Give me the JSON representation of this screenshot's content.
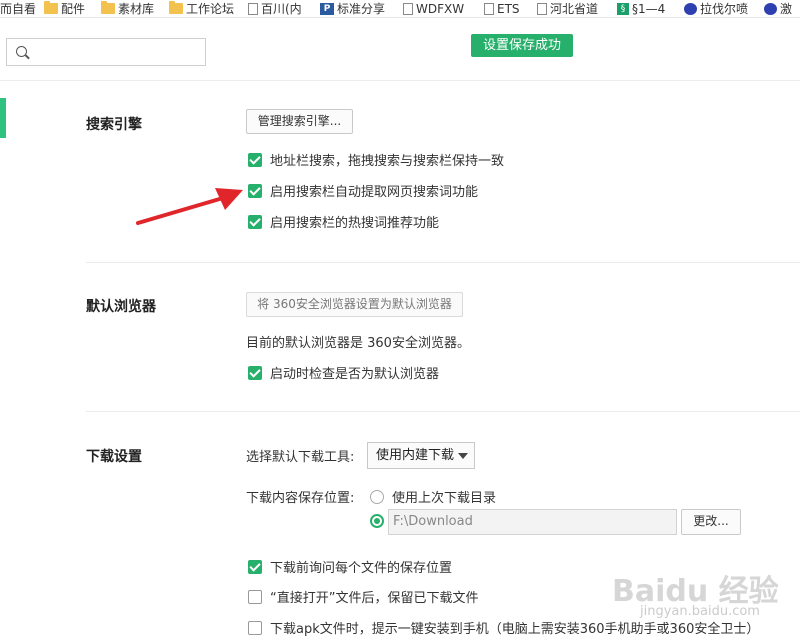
{
  "bookmarks": [
    {
      "label": "而自看",
      "icon": "none"
    },
    {
      "label": "配件",
      "icon": "folder-icon"
    },
    {
      "label": "素材库",
      "icon": "folder-icon"
    },
    {
      "label": "工作论坛",
      "icon": "folder-icon"
    },
    {
      "label": "百川(内",
      "icon": "page-icon"
    },
    {
      "label": "标准分享",
      "icon": "logo-icon"
    },
    {
      "label": "WDFXW",
      "icon": "page-icon"
    },
    {
      "label": "ETS",
      "icon": "page-icon"
    },
    {
      "label": "河北省道",
      "icon": "page-icon"
    },
    {
      "label": "§1—4",
      "icon": "green-icon"
    },
    {
      "label": "拉伐尔喷",
      "icon": "paw-icon"
    },
    {
      "label": "激",
      "icon": "paw-icon"
    }
  ],
  "search": {
    "placeholder": ""
  },
  "toast": "设置保存成功",
  "search_engine": {
    "title": "搜索引擎",
    "manage_button": "管理搜索引擎...",
    "options": [
      {
        "label": "地址栏搜索，拖拽搜索与搜索栏保持一致",
        "checked": true
      },
      {
        "label": "启用搜索栏自动提取网页搜索词功能",
        "checked": true
      },
      {
        "label": "启用搜索栏的热搜词推荐功能",
        "checked": true
      }
    ]
  },
  "default_browser": {
    "title": "默认浏览器",
    "set_button": "将 360安全浏览器设置为默认浏览器",
    "status": "目前的默认浏览器是 360安全浏览器。",
    "check_on_start": {
      "label": "启动时检查是否为默认浏览器",
      "checked": true
    }
  },
  "download": {
    "title": "下载设置",
    "tool_label": "选择默认下载工具:",
    "tool_value": "使用内建下载",
    "location_label": "下载内容保存位置:",
    "use_last_dir": "使用上次下载目录",
    "path_value": "F:\\Download",
    "change_button": "更改...",
    "options": [
      {
        "label": "下载前询问每个文件的保存位置",
        "checked": true
      },
      {
        "label": "“直接打开”文件后，保留已下载文件",
        "checked": false
      },
      {
        "label": "下载apk文件时，提示一键安装到手机（电脑上需安装360手机助手或360安全卫士）",
        "checked": false
      }
    ]
  },
  "colors": {
    "accent": "#27b06b",
    "arrow": "#e0262b"
  },
  "watermark": {
    "text": "Baidu 经验",
    "sub": "jingyan.baidu.com"
  }
}
